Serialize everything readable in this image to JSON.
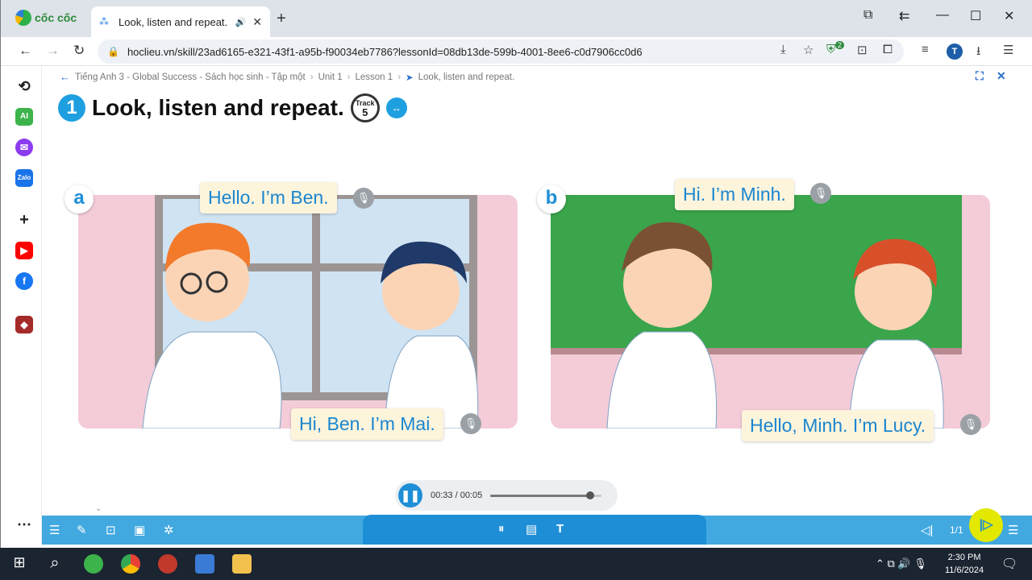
{
  "browser": {
    "brand": "cốc cốc",
    "tab_title": "Look, listen and repeat. | ",
    "url": "hoclieu.vn/skill/23ad6165-e321-43f1-a95b-f90034eb7786?lessonId=08db13de-599b-4001-8ee6-c0d7906cc0d6",
    "extension_badge": "2",
    "avatar_letter": "T"
  },
  "breadcrumb": [
    "Tiếng Anh 3 - Global Success - Sách học sinh - Tập một",
    "Unit 1",
    "Lesson 1",
    "Look, listen and repeat."
  ],
  "activity": {
    "number": "1",
    "title": "Look, listen and repeat.",
    "track_label": "Track",
    "track_number": "5"
  },
  "panels": [
    {
      "letter": "a",
      "bubbles": [
        "Hello. I’m Ben.",
        "Hi, Ben. I’m Mai."
      ]
    },
    {
      "letter": "b",
      "bubbles": [
        "Hi. I’m Minh.",
        "Hello, Minh. I’m Lucy."
      ]
    }
  ],
  "audio": {
    "time": "00:33 / 00:05",
    "progress": 0.9
  },
  "pager": {
    "label": "1/1"
  },
  "taskbar": {
    "time": "2:30 PM",
    "date": "11/6/2024"
  },
  "colors": {
    "accent": "#1e8fd6",
    "bubble_text": "#1a86cf",
    "toolbar": "#41a9e0"
  }
}
